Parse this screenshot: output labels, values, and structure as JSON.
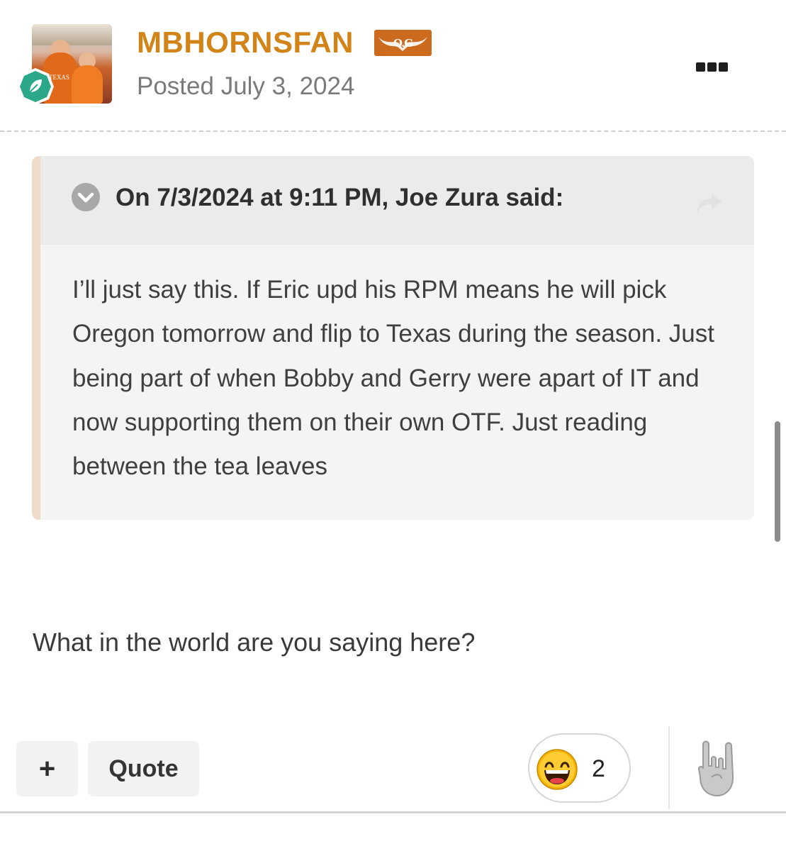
{
  "post": {
    "author": "MBHORNSFAN",
    "author_badge": "O.G",
    "posted": "Posted July 3, 2024",
    "avatar_shirt_text": "TEXAS"
  },
  "quote": {
    "citation": "On 7/3/2024 at 9:11 PM, Joe Zura said:",
    "body": "I’ll just say this. If Eric upd his RPM means he will pick Oregon tomorrow and flip to Texas during the season. Just being part of when Bobby and Gerry were apart of IT and now supporting them on their own OTF. Just reading between the tea leaves"
  },
  "reply": {
    "text": "What in the world are you saying here?"
  },
  "actions": {
    "plus_label": "+",
    "quote_label": "Quote",
    "reaction_count": "2",
    "reaction_emoji": "grinning-face-icon",
    "react_icon": "horns-hand-icon"
  },
  "colors": {
    "username": "#d28418",
    "badge": "#cc6b1d",
    "rank_badge": "#2aa889",
    "quote_accent": "#efdcc8"
  }
}
